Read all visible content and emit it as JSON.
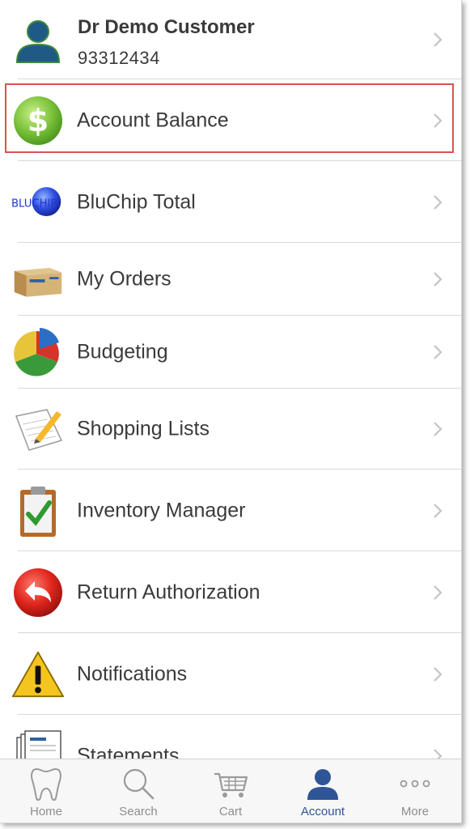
{
  "profile": {
    "name": "Dr Demo Customer",
    "account_number": "93312434"
  },
  "menu": {
    "account_balance": "Account Balance",
    "bluchip_total": "BluChip Total",
    "bluchip_logo_text": "BLUCHIP",
    "my_orders": "My Orders",
    "budgeting": "Budgeting",
    "shopping_lists": "Shopping Lists",
    "inventory_manager": "Inventory Manager",
    "return_authorization": "Return Authorization",
    "notifications": "Notifications",
    "statements": "Statements"
  },
  "tabs": {
    "home": "Home",
    "search": "Search",
    "cart": "Cart",
    "account": "Account",
    "more": "More",
    "active": "account"
  },
  "colors": {
    "highlight": "#d9534f",
    "active_tab": "#2f5597",
    "inactive_tab": "#8e8e8e"
  }
}
